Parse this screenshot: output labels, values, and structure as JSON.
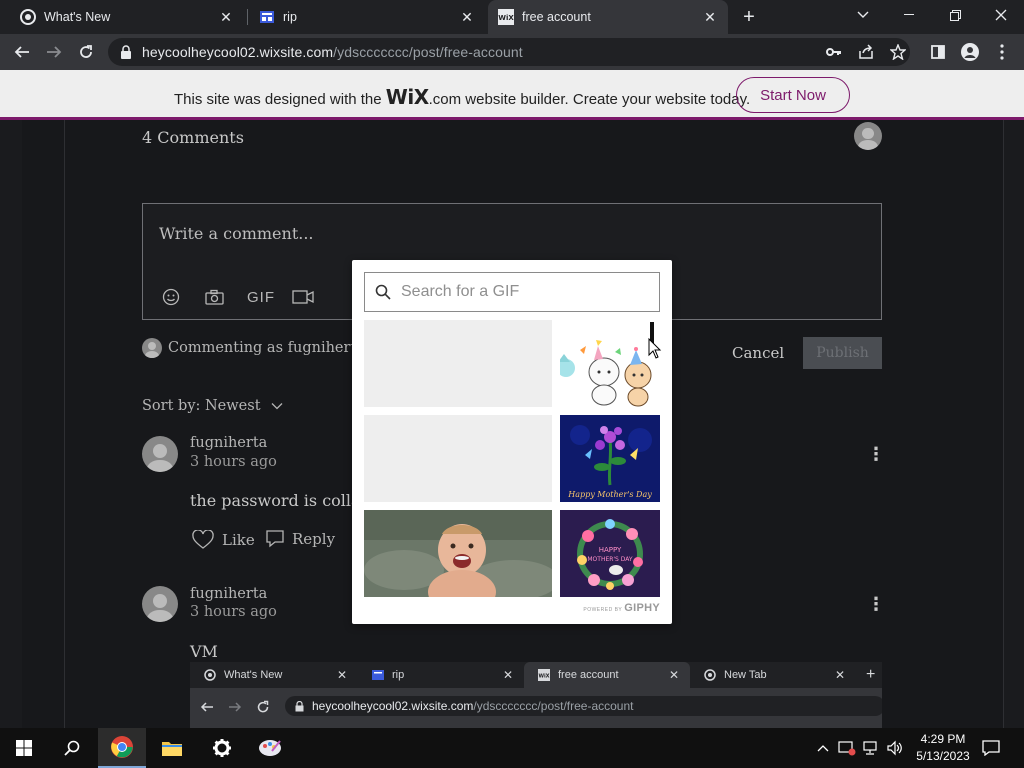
{
  "browser": {
    "tabs": [
      {
        "title": "What's New",
        "active": false
      },
      {
        "title": "rip",
        "active": false
      },
      {
        "title": "free account",
        "active": true
      }
    ],
    "url_host": "heycoolheycool02.wixsite.com",
    "url_path": "/ydsccccccc/post/free-account"
  },
  "wix_banner": {
    "prefix": "This site was designed with the",
    "brand": "WiX",
    "suffix": ".com website builder. Create your website today.",
    "cta": "Start Now"
  },
  "comments": {
    "title": "4 Comments",
    "input_placeholder": "Write a comment...",
    "toolbar": {
      "gif_label": "GIF"
    },
    "commenting_as": "Commenting as fugniherta",
    "cancel_label": "Cancel",
    "publish_label": "Publish",
    "sort_label": "Sort by: Newest",
    "items": [
      {
        "author": "fugniherta",
        "time": "3 hours ago",
        "body": "the password is collaby",
        "like": "Like",
        "reply": "Reply"
      },
      {
        "author": "fugniherta",
        "time": "3 hours ago",
        "body": "VM"
      }
    ]
  },
  "gif_picker": {
    "search_placeholder": "Search for a GIF",
    "powered_by": "POWERED BY",
    "provider": "GIPHY"
  },
  "inner_browser": {
    "tabs": [
      {
        "title": "What's New"
      },
      {
        "title": "rip"
      },
      {
        "title": "free account"
      },
      {
        "title": "New Tab"
      }
    ],
    "url_host": "heycoolheycool02.wixsite.com",
    "url_path": "/ydsccccccc/post/free-account"
  },
  "taskbar": {
    "time": "4:29 PM",
    "date": "5/13/2023"
  },
  "colors": {
    "wix_accent": "#7d1a6b",
    "page_bg": "#17181b",
    "chrome_dark": "#202124",
    "chrome_toolbar": "#35363a"
  }
}
